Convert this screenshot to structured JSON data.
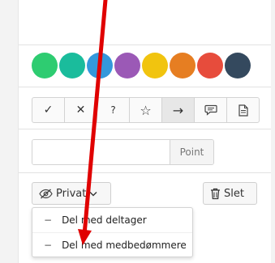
{
  "colors": {
    "swatches": [
      "#2ecc71",
      "#1abc9c",
      "#3498db",
      "#9b59b6",
      "#f1c40f",
      "#e67e22",
      "#e74c3c",
      "#34495e"
    ],
    "annotation_arrow": "#e00000"
  },
  "toolbar": {
    "tools": [
      {
        "name": "check-icon",
        "glyph": "✓"
      },
      {
        "name": "cross-icon",
        "glyph": "✕"
      },
      {
        "name": "question-icon",
        "glyph": "?"
      },
      {
        "name": "star-icon",
        "glyph": "☆"
      },
      {
        "name": "arrow-right-icon",
        "glyph": "→"
      },
      {
        "name": "comment-icon",
        "glyph": ""
      },
      {
        "name": "document-icon",
        "glyph": ""
      }
    ]
  },
  "point": {
    "addon": "Point",
    "value": "",
    "placeholder": ""
  },
  "privacy": {
    "label": "Privat"
  },
  "delete": {
    "label": "Slet"
  },
  "share_menu": {
    "items": [
      "Del med deltager",
      "Del med medbedømmere"
    ]
  }
}
